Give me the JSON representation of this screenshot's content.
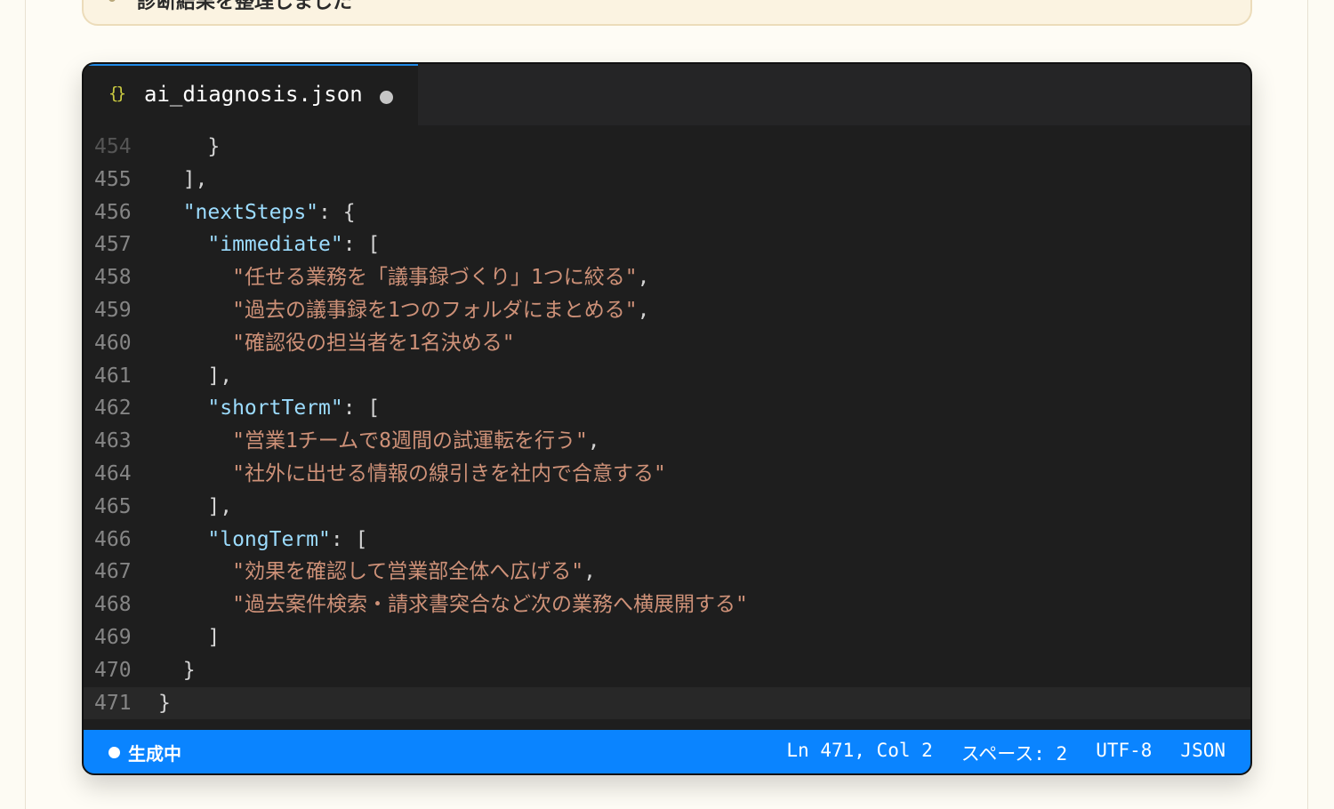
{
  "page": {
    "previous_card_text": "診断結果を整理しました"
  },
  "editor": {
    "tab": {
      "icon": "{}",
      "filename": "ai_diagnosis.json",
      "modified_indicator": "unsaved-dot"
    },
    "lines": [
      {
        "num": "454",
        "parts": [
          {
            "t": "    }",
            "c": "p"
          }
        ],
        "faded": true
      },
      {
        "num": "455",
        "parts": [
          {
            "t": "  ],",
            "c": "p"
          }
        ]
      },
      {
        "num": "456",
        "parts": [
          {
            "t": "  ",
            "c": "p"
          },
          {
            "t": "\"nextSteps\"",
            "c": "k"
          },
          {
            "t": ": {",
            "c": "p"
          }
        ]
      },
      {
        "num": "457",
        "parts": [
          {
            "t": "    ",
            "c": "p"
          },
          {
            "t": "\"immediate\"",
            "c": "k"
          },
          {
            "t": ": [",
            "c": "p"
          }
        ]
      },
      {
        "num": "458",
        "parts": [
          {
            "t": "      ",
            "c": "p"
          },
          {
            "t": "\"任せる業務を「議事録づくり」1つに絞る\"",
            "c": "s"
          },
          {
            "t": ",",
            "c": "p"
          }
        ]
      },
      {
        "num": "459",
        "parts": [
          {
            "t": "      ",
            "c": "p"
          },
          {
            "t": "\"過去の議事録を1つのフォルダにまとめる\"",
            "c": "s"
          },
          {
            "t": ",",
            "c": "p"
          }
        ]
      },
      {
        "num": "460",
        "parts": [
          {
            "t": "      ",
            "c": "p"
          },
          {
            "t": "\"確認役の担当者を1名決める\"",
            "c": "s"
          }
        ]
      },
      {
        "num": "461",
        "parts": [
          {
            "t": "    ],",
            "c": "p"
          }
        ]
      },
      {
        "num": "462",
        "parts": [
          {
            "t": "    ",
            "c": "p"
          },
          {
            "t": "\"shortTerm\"",
            "c": "k"
          },
          {
            "t": ": [",
            "c": "p"
          }
        ]
      },
      {
        "num": "463",
        "parts": [
          {
            "t": "      ",
            "c": "p"
          },
          {
            "t": "\"営業1チームで8週間の試運転を行う\"",
            "c": "s"
          },
          {
            "t": ",",
            "c": "p"
          }
        ]
      },
      {
        "num": "464",
        "parts": [
          {
            "t": "      ",
            "c": "p"
          },
          {
            "t": "\"社外に出せる情報の線引きを社内で合意する\"",
            "c": "s"
          }
        ]
      },
      {
        "num": "465",
        "parts": [
          {
            "t": "    ],",
            "c": "p"
          }
        ]
      },
      {
        "num": "466",
        "parts": [
          {
            "t": "    ",
            "c": "p"
          },
          {
            "t": "\"longTerm\"",
            "c": "k"
          },
          {
            "t": ": [",
            "c": "p"
          }
        ]
      },
      {
        "num": "467",
        "parts": [
          {
            "t": "      ",
            "c": "p"
          },
          {
            "t": "\"効果を確認して営業部全体へ広げる\"",
            "c": "s"
          },
          {
            "t": ",",
            "c": "p"
          }
        ]
      },
      {
        "num": "468",
        "parts": [
          {
            "t": "      ",
            "c": "p"
          },
          {
            "t": "\"過去案件検索・請求書突合など次の業務へ横展開する\"",
            "c": "s"
          }
        ]
      },
      {
        "num": "469",
        "parts": [
          {
            "t": "    ]",
            "c": "p"
          }
        ]
      },
      {
        "num": "470",
        "parts": [
          {
            "t": "  }",
            "c": "p"
          }
        ]
      },
      {
        "num": "471",
        "parts": [
          {
            "t": "}",
            "c": "p"
          }
        ],
        "current": true
      }
    ]
  },
  "statusbar": {
    "state_label": "生成中",
    "position": "Ln 471, Col 2",
    "indent": "スペース: 2",
    "encoding": "UTF-8",
    "language": "JSON"
  },
  "colors": {
    "accent": "#0a84ff",
    "json_key": "#9cdcfe",
    "json_string": "#ce9178",
    "editor_bg": "#1e1e1e"
  }
}
